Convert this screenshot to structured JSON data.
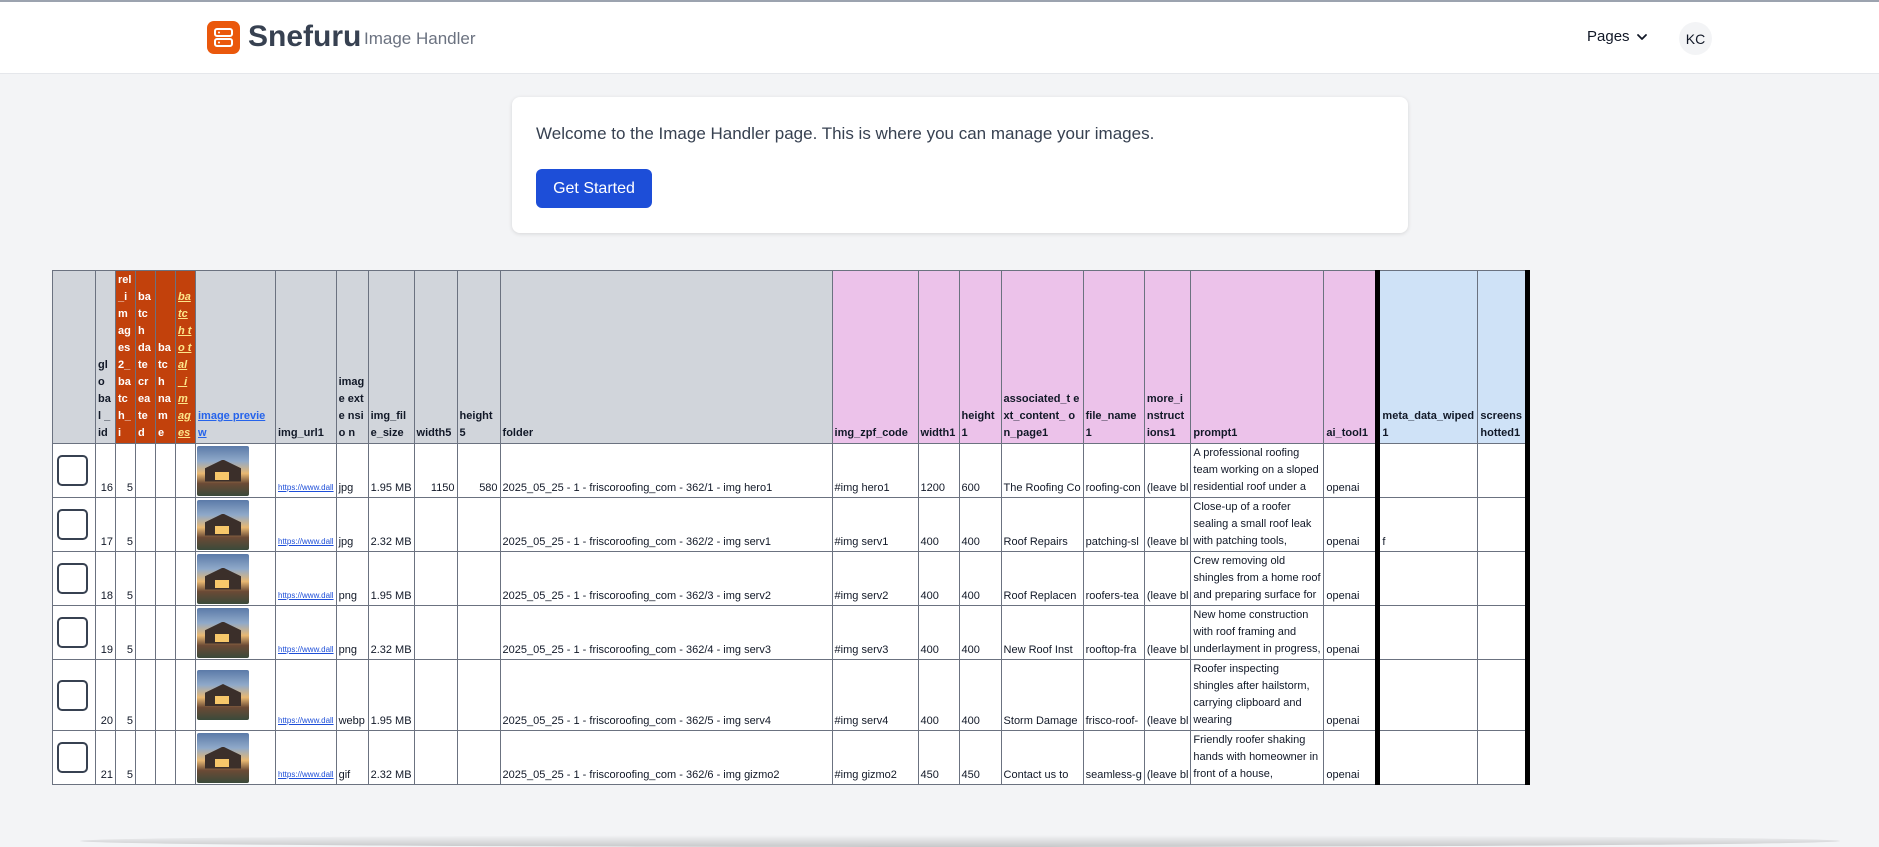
{
  "header": {
    "logo_text": "Snefuru",
    "page_subtitle": "Image Handler",
    "pages_label": "Pages",
    "avatar_initials": "KC"
  },
  "welcome": {
    "text": "Welcome to the Image Handler page. This is where you can manage your images.",
    "button_label": "Get Started"
  },
  "table": {
    "headers": {
      "global_id": "glo bal _id",
      "rel_images": "rel _i m ag es 2_ ba tc h_i",
      "batch_date": "ba tc h da te cr ea te d",
      "batch_name": "ba tc h na m e",
      "batch_total": "ba tc h to tal _im ag es",
      "image_preview": "image preview",
      "img_url1": "img_url1",
      "image_extension": "image exte nsio n",
      "img_file_size": "img_fil e_size",
      "width5": "width5",
      "height5": "height5",
      "folder": "folder",
      "img_zpf_code": "img_zpf_code",
      "width1": "width1",
      "height1": "height1",
      "associated": "associated_t ext_content_ on_page1",
      "file_name": "file_name 1",
      "more_instructions": "more_i nstruct ions1",
      "prompt1": "prompt1",
      "ai_tool1": "ai_tool1",
      "meta_data_wiped1": "meta_data_wiped1",
      "screenshotted1": "screens hotted1"
    },
    "rows": [
      {
        "id": "16",
        "batch": "5",
        "url": "https://www.dall",
        "ext": "jpg",
        "size": "1.95 MB",
        "width5": "1150",
        "height5": "580",
        "folder": "2025_05_25 - 1 - friscoroofing_com - 362/1 - img hero1",
        "zpf": "#img hero1",
        "w1": "1200",
        "h1": "600",
        "assoc": "The Roofing Co",
        "fname": "roofing-con",
        "more": "(leave bl",
        "prompt": "A professional roofing team working on a sloped residential roof under a",
        "ai": "openai",
        "wiped": "",
        "shot": ""
      },
      {
        "id": "17",
        "batch": "5",
        "url": "https://www.dall",
        "ext": "jpg",
        "size": "2.32 MB",
        "width5": "",
        "height5": "",
        "folder": "2025_05_25 - 1 - friscoroofing_com - 362/2 - img serv1",
        "zpf": "#img serv1",
        "w1": "400",
        "h1": "400",
        "assoc": "Roof Repairs",
        "fname": "patching-sl",
        "more": "(leave bl",
        "prompt": "Close-up of a roofer sealing a small roof leak with patching tools,",
        "ai": "openai",
        "wiped": "f",
        "shot": ""
      },
      {
        "id": "18",
        "batch": "5",
        "url": "https://www.dall",
        "ext": "png",
        "size": "1.95 MB",
        "width5": "",
        "height5": "",
        "folder": "2025_05_25 - 1 - friscoroofing_com - 362/3 - img serv2",
        "zpf": "#img serv2",
        "w1": "400",
        "h1": "400",
        "assoc": "Roof Replacen",
        "fname": "roofers-tea",
        "more": "(leave bl",
        "prompt": "Crew removing old shingles from a home roof and preparing surface for",
        "ai": "openai",
        "wiped": "",
        "shot": ""
      },
      {
        "id": "19",
        "batch": "5",
        "url": "https://www.dall",
        "ext": "png",
        "size": "2.32 MB",
        "width5": "",
        "height5": "",
        "folder": "2025_05_25 - 1 - friscoroofing_com - 362/4 - img serv3",
        "zpf": "#img serv3",
        "w1": "400",
        "h1": "400",
        "assoc": "New Roof Inst",
        "fname": "rooftop-fra",
        "more": "(leave bl",
        "prompt": "New home construction with roof framing and underlayment in progress,",
        "ai": "openai",
        "wiped": "",
        "shot": ""
      },
      {
        "id": "20",
        "batch": "5",
        "url": "https://www.dall",
        "ext": "webp",
        "size": "1.95 MB",
        "width5": "",
        "height5": "",
        "folder": "2025_05_25 - 1 - friscoroofing_com - 362/5 - img serv4",
        "zpf": "#img serv4",
        "w1": "400",
        "h1": "400",
        "assoc": "Storm Damage",
        "fname": "frisco-roof-",
        "more": "(leave bl",
        "prompt": "Roofer inspecting shingles after hailstorm, carrying clipboard and wearing",
        "ai": "openai",
        "wiped": "",
        "shot": ""
      },
      {
        "id": "21",
        "batch": "5",
        "url": "https://www.dall",
        "ext": "gif",
        "size": "2.32 MB",
        "width5": "",
        "height5": "",
        "folder": "2025_05_25 - 1 - friscoroofing_com - 362/6 - img gizmo2",
        "zpf": "#img gizmo2",
        "w1": "450",
        "h1": "450",
        "assoc": "Contact us to",
        "fname": "seamless-g",
        "more": "(leave bl",
        "prompt": "Friendly roofer shaking hands with homeowner in front of a house,",
        "ai": "openai",
        "wiped": "",
        "shot": ""
      }
    ]
  },
  "colors": {
    "logo_accent": "#ea580c",
    "primary_button": "#1d4ed8",
    "header_gray": "#d1d5db",
    "header_pink": "#ecc2ea",
    "header_blue": "#cfe2f7",
    "header_orange": "#c2410c"
  },
  "icons": {
    "logo": "server-stack-icon",
    "pages_dropdown": "chevron-down-icon",
    "row_select": "checkbox-icon",
    "preview": "image-thumbnail-icon"
  }
}
